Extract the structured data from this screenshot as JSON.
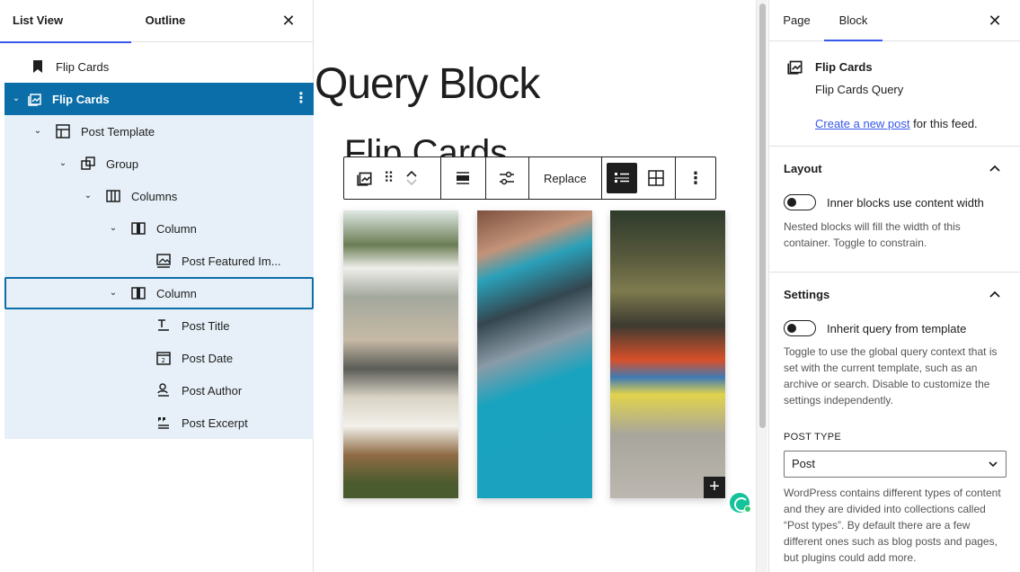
{
  "left_panel": {
    "tabs": [
      "List View",
      "Outline"
    ],
    "items": [
      {
        "label": "Flip Cards",
        "depth": 0
      },
      {
        "label": "Flip Cards",
        "depth": 0
      },
      {
        "label": "Post Template",
        "depth": 1
      },
      {
        "label": "Group",
        "depth": 2
      },
      {
        "label": "Columns",
        "depth": 3
      },
      {
        "label": "Column",
        "depth": 4
      },
      {
        "label": "Post Featured Im...",
        "depth": 5
      },
      {
        "label": "Column",
        "depth": 4
      },
      {
        "label": "Post Title",
        "depth": 5
      },
      {
        "label": "Post Date",
        "depth": 5
      },
      {
        "label": "Post Author",
        "depth": 5
      },
      {
        "label": "Post Excerpt",
        "depth": 5
      }
    ]
  },
  "canvas": {
    "page_title": "Query Block",
    "heading": "Flip Cards",
    "toolbar": {
      "replace_label": "Replace"
    }
  },
  "right_panel": {
    "tabs": [
      "Page",
      "Block"
    ],
    "block": {
      "title": "Flip Cards",
      "description": "Flip Cards Query",
      "create_link": "Create a new post",
      "create_suffix": " for this feed."
    },
    "layout": {
      "title": "Layout",
      "toggle_label": "Inner blocks use content width",
      "help": "Nested blocks will fill the width of this container. Toggle to constrain."
    },
    "settings": {
      "title": "Settings",
      "toggle_label": "Inherit query from template",
      "help": "Toggle to use the global query context that is set with the current template, such as an archive or search. Disable to customize the settings independently.",
      "post_type_label": "POST TYPE",
      "post_type_value": "Post",
      "post_type_help": "WordPress contains different types of content and they are divided into collections called “Post types”. By default there are a few different ones such as blog posts and pages, but plugins could add more."
    }
  },
  "colors": {
    "selected_row": "#0b6ea8",
    "tree_highlight": "#e7f0f8",
    "accent": "#3858e9",
    "grammarly": "#15c39a"
  }
}
